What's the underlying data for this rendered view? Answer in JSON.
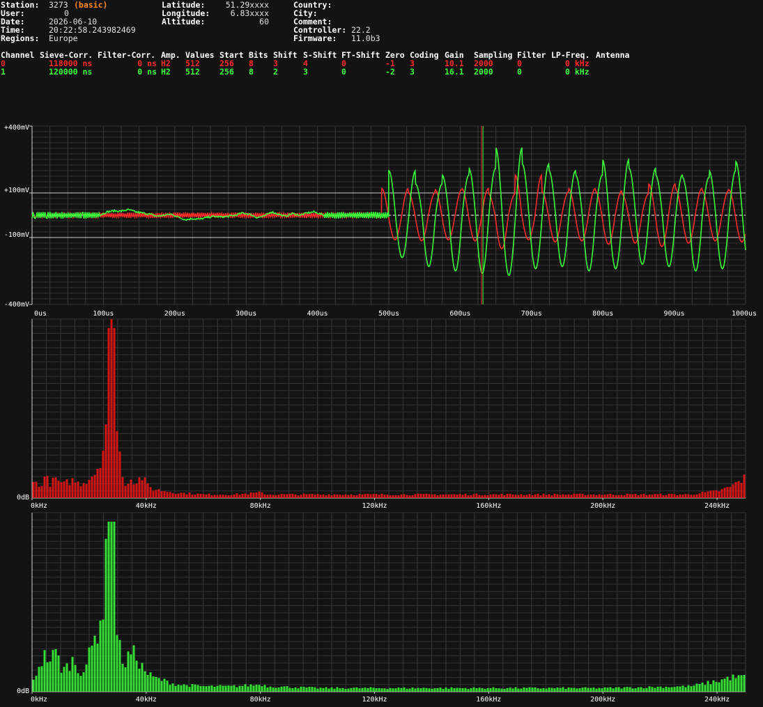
{
  "station": {
    "left": [
      {
        "label": "Station:",
        "value": "3273"
      },
      {
        "label": "User:",
        "value": "0"
      },
      {
        "label": "Date:",
        "value": "2026-06-10"
      },
      {
        "label": "Time:",
        "value": "20:22:58.243982469"
      },
      {
        "label": "Regions:",
        "value": "Europe"
      }
    ],
    "station_mode": "(basic)",
    "mid": [
      {
        "label": "Latitude:",
        "value": "51.29xxxx"
      },
      {
        "label": "Longitude:",
        "value": "6.83xxxx"
      },
      {
        "label": "Altitude:",
        "value": "60"
      }
    ],
    "right": [
      {
        "label": "Country:",
        "value": ""
      },
      {
        "label": "City:",
        "value": ""
      },
      {
        "label": "Comment:",
        "value": ""
      },
      {
        "label": "Controller:",
        "value": "22.2"
      },
      {
        "label": "Firmware:",
        "value": "11.0b3"
      }
    ]
  },
  "channels": {
    "headers": [
      "Channel",
      "Sieve-Corr.",
      "Filter-Corr.",
      "Amp.",
      "Values",
      "Start",
      "Bits",
      "Shift",
      "S-Shift",
      "FT-Shift",
      "Zero",
      "Coding",
      "Gain",
      "Sampling",
      "Filter",
      "LP-Freq.",
      "Antenna"
    ],
    "rows": [
      {
        "color": "#ff2a2a",
        "cells": [
          "0",
          "118000 ns",
          "0 ns",
          "H2",
          "512",
          "256",
          "8",
          "3",
          "4",
          "0",
          "-1",
          "3",
          "10.1",
          "2000",
          "0",
          "0 kHz",
          ""
        ]
      },
      {
        "color": "#3cff3c",
        "cells": [
          "1",
          "120000 ns",
          "0 ns",
          "H2",
          "512",
          "256",
          "8",
          "2",
          "3",
          "0",
          "-2",
          "3",
          "16.1",
          "2000",
          "0",
          "0 kHz",
          ""
        ]
      }
    ]
  },
  "chart_data": [
    {
      "type": "line",
      "name": "waveform",
      "xlim": [
        0,
        1000
      ],
      "ylim": [
        -400,
        400
      ],
      "y_tick_labels": [
        "+400mV",
        "+100mV",
        "-100mV",
        "-400mV"
      ],
      "y_tick_values": [
        400,
        100,
        -100,
        -400
      ],
      "x_tick_labels": [
        "0us",
        "100us",
        "200us",
        "300us",
        "400us",
        "500us",
        "600us",
        "700us",
        "800us",
        "900us",
        "1000us"
      ],
      "x_tick_values": [
        0,
        100,
        200,
        300,
        400,
        500,
        600,
        700,
        800,
        900,
        1000
      ],
      "grid": true,
      "marker_x": [
        630,
        632
      ],
      "marker_colors": [
        "#ff2a2a",
        "#3cff3c"
      ],
      "series": [
        {
          "color": "#ff2a2a",
          "segments": [
            {
              "kind": "noise",
              "x0": 0,
              "x1": 95,
              "amp": 10
            },
            {
              "kind": "noise",
              "x0": 95,
              "x1": 400,
              "amp": 12
            },
            {
              "kind": "noise",
              "x0": 400,
              "x1": 490,
              "amp": 10
            },
            {
              "kind": "sine",
              "x0": 490,
              "x1": 1000,
              "period": 37.4,
              "peaks": [
                120,
                100,
                115,
                120,
                95,
                180,
                105,
                120,
                110,
                95,
                140,
                120,
                110,
                115,
                110,
                110,
                105,
                100
              ],
              "troughs": [
                -110,
                -115,
                -110,
                -115,
                -150,
                -110,
                -120,
                -115,
                -130,
                -125,
                -140,
                -125,
                -115,
                -120,
                -125,
                -120,
                -115,
                -110
              ]
            }
          ]
        },
        {
          "color": "#3cff3c",
          "segments": [
            {
              "kind": "noise",
              "x0": 0,
              "x1": 95,
              "amp": 15
            },
            {
              "kind": "wander",
              "x0": 95,
              "x1": 410,
              "points": [
                [
                  95,
                  0
                ],
                [
                  105,
                  15
                ],
                [
                  115,
                  20
                ],
                [
                  125,
                  18
                ],
                [
                  135,
                  25
                ],
                [
                  145,
                  15
                ],
                [
                  155,
                  10
                ],
                [
                  165,
                  5
                ],
                [
                  175,
                  -5
                ],
                [
                  185,
                  0
                ],
                [
                  195,
                  5
                ],
                [
                  205,
                  -8
                ],
                [
                  215,
                  -20
                ],
                [
                  225,
                  -15
                ],
                [
                  235,
                  -18
                ],
                [
                  245,
                  -10
                ],
                [
                  255,
                  -5
                ],
                [
                  265,
                  -8
                ],
                [
                  275,
                  -5
                ],
                [
                  285,
                  0
                ],
                [
                  295,
                  10
                ],
                [
                  305,
                  5
                ],
                [
                  315,
                  -10
                ],
                [
                  325,
                  -5
                ],
                [
                  335,
                  15
                ],
                [
                  345,
                  5
                ],
                [
                  355,
                  -5
                ],
                [
                  365,
                  8
                ],
                [
                  375,
                  0
                ],
                [
                  385,
                  10
                ],
                [
                  395,
                  15
                ],
                [
                  410,
                  0
                ]
              ]
            },
            {
              "kind": "noise",
              "x0": 410,
              "x1": 500,
              "amp": 15
            },
            {
              "kind": "sine",
              "x0": 500,
              "x1": 1000,
              "period": 37.4,
              "peaks": [
                200,
                140,
                180,
                210,
                305,
                230,
                200,
                180,
                250,
                210,
                180,
                170,
                200,
                240,
                235,
                220,
                205,
                170
              ],
              "troughs": [
                -190,
                -230,
                -250,
                -260,
                -270,
                -240,
                -230,
                -250,
                -240,
                -220,
                -230,
                -250,
                -240,
                -230,
                -240,
                -230,
                -220,
                -190
              ]
            }
          ]
        }
      ]
    },
    {
      "type": "bar",
      "name": "spectrum-ch0",
      "color": "#d41515",
      "xlim": [
        0,
        250
      ],
      "x_tick_labels": [
        "0kHz",
        "40kHz",
        "80kHz",
        "120kHz",
        "160kHz",
        "200kHz",
        "240kHz"
      ],
      "x_tick_values": [
        0,
        40,
        80,
        120,
        160,
        200,
        240
      ],
      "y_label": "0dB",
      "grid": true,
      "peak_profile": [
        [
          0,
          10
        ],
        [
          2,
          6
        ],
        [
          4,
          12
        ],
        [
          6,
          8
        ],
        [
          8,
          11
        ],
        [
          10,
          7
        ],
        [
          12,
          9
        ],
        [
          14,
          10
        ],
        [
          16,
          8
        ],
        [
          18,
          9
        ],
        [
          20,
          12
        ],
        [
          22,
          15
        ],
        [
          24,
          25
        ],
        [
          25,
          32
        ],
        [
          26,
          60
        ],
        [
          27,
          100
        ],
        [
          28,
          95
        ],
        [
          29,
          42
        ],
        [
          30,
          30
        ],
        [
          31,
          12
        ],
        [
          32,
          8
        ],
        [
          34,
          11
        ],
        [
          36,
          9
        ],
        [
          38,
          12
        ],
        [
          40,
          7
        ],
        [
          42,
          5
        ],
        [
          46,
          4
        ],
        [
          50,
          3
        ],
        [
          60,
          2
        ],
        [
          70,
          2
        ],
        [
          80,
          3
        ],
        [
          82,
          2
        ],
        [
          100,
          2
        ],
        [
          120,
          2
        ],
        [
          150,
          2
        ],
        [
          180,
          2
        ],
        [
          200,
          2
        ],
        [
          230,
          2
        ],
        [
          240,
          4
        ],
        [
          244,
          6
        ],
        [
          248,
          10
        ],
        [
          250,
          12
        ]
      ]
    },
    {
      "type": "bar",
      "name": "spectrum-ch1",
      "color": "#33e033",
      "xlim": [
        0,
        250
      ],
      "x_tick_labels": [
        "0kHz",
        "40kHz",
        "80kHz",
        "120kHz",
        "160kHz",
        "200kHz",
        "240kHz"
      ],
      "x_tick_values": [
        0,
        40,
        80,
        120,
        160,
        200,
        240
      ],
      "y_label": "0dB",
      "grid": true,
      "peak_profile": [
        [
          0,
          6
        ],
        [
          2,
          15
        ],
        [
          4,
          20
        ],
        [
          6,
          18
        ],
        [
          8,
          22
        ],
        [
          10,
          12
        ],
        [
          12,
          14
        ],
        [
          14,
          18
        ],
        [
          16,
          11
        ],
        [
          18,
          13
        ],
        [
          20,
          22
        ],
        [
          22,
          32
        ],
        [
          24,
          45
        ],
        [
          25,
          50
        ],
        [
          26,
          100
        ],
        [
          27,
          95
        ],
        [
          28,
          90
        ],
        [
          29,
          40
        ],
        [
          30,
          25
        ],
        [
          31,
          20
        ],
        [
          32,
          15
        ],
        [
          34,
          22
        ],
        [
          36,
          20
        ],
        [
          38,
          14
        ],
        [
          40,
          10
        ],
        [
          42,
          8
        ],
        [
          46,
          6
        ],
        [
          50,
          4
        ],
        [
          60,
          3
        ],
        [
          70,
          3
        ],
        [
          80,
          4
        ],
        [
          82,
          3
        ],
        [
          100,
          2
        ],
        [
          120,
          2
        ],
        [
          150,
          2
        ],
        [
          180,
          2
        ],
        [
          200,
          2
        ],
        [
          230,
          3
        ],
        [
          240,
          6
        ],
        [
          244,
          8
        ],
        [
          248,
          8
        ],
        [
          250,
          9
        ]
      ]
    }
  ]
}
